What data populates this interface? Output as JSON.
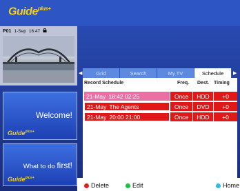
{
  "logo": {
    "text": "Guide",
    "plus": "plus+"
  },
  "info": {
    "channel": "P01",
    "date": "1-Sep",
    "time": "16:47",
    "lock_icon": "lock-icon"
  },
  "promos": [
    {
      "text": "Welcome!",
      "logo": "Guide",
      "plus": "plus+"
    },
    {
      "text_small": "What to do",
      "text_big": "first!",
      "logo": "Guide",
      "plus": "plus+"
    }
  ],
  "tabs": [
    {
      "label": "Grid",
      "active": false
    },
    {
      "label": "Search",
      "active": false
    },
    {
      "label": "My TV",
      "active": false
    },
    {
      "label": "Schedule",
      "active": true
    }
  ],
  "schedule": {
    "headers": {
      "title": "Record Schedule",
      "freq": "Freq.",
      "dest": "Dest.",
      "timing": "Timing"
    },
    "rows": [
      {
        "date": "21-May",
        "program": "18:42  02:25",
        "freq": "Once",
        "dest": "HDD",
        "timing": "+0",
        "selected": true
      },
      {
        "date": "21-May",
        "program": "The Agents",
        "freq": "Once",
        "dest": "DVD",
        "timing": "+0",
        "selected": false
      },
      {
        "date": "21-May",
        "program": "20:00  21:00",
        "freq": "Once",
        "dest": "HDD",
        "timing": "+0",
        "selected": false
      }
    ]
  },
  "footer": {
    "delete": {
      "label": "Delete",
      "color": "#e02020"
    },
    "edit": {
      "label": "Edit",
      "color": "#20c040"
    },
    "home": {
      "label": "Home",
      "color": "#30b8e8"
    }
  }
}
